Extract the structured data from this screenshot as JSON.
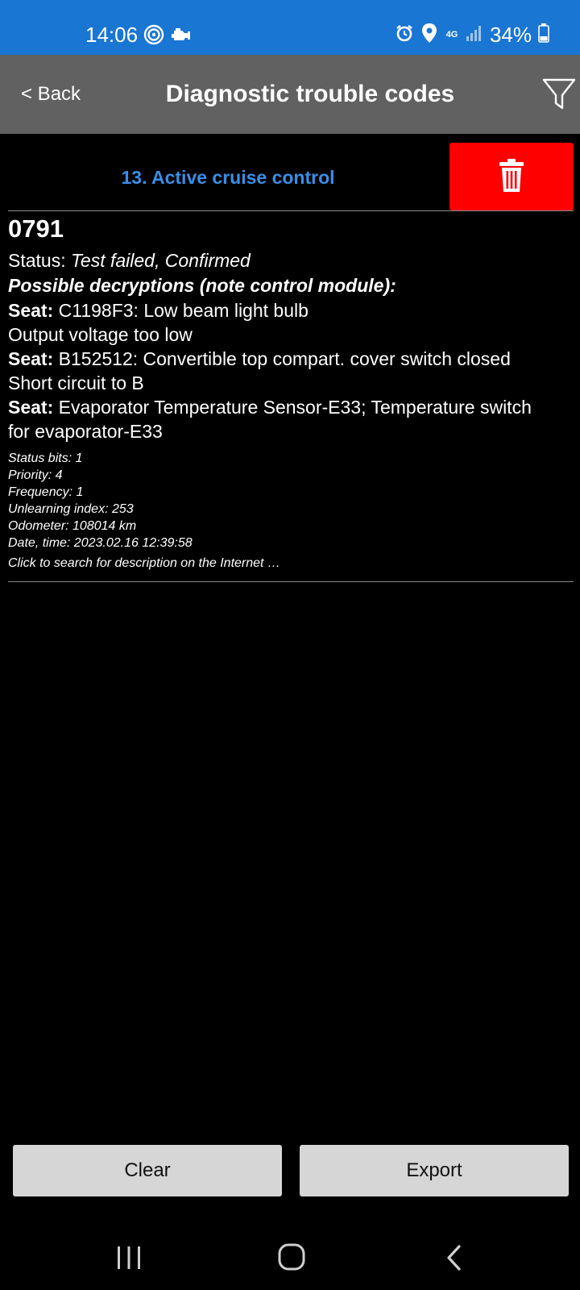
{
  "status_bar": {
    "time": "14:06",
    "network": "4G",
    "battery": "34%"
  },
  "header": {
    "back_label": "< Back",
    "title": "Diagnostic trouble codes"
  },
  "module": {
    "title": "13. Active cruise control"
  },
  "dtc": {
    "code": "0791",
    "status_label": "Status: ",
    "status_value": "Test failed, Confirmed",
    "possible_heading": "Possible decryptions (note control module):",
    "decryptions": [
      {
        "label": "Seat:",
        "line1": " C1198F3: Low beam light bulb",
        "line2": "Output voltage too low"
      },
      {
        "label": "Seat:",
        "line1": " B152512: Convertible top compart. cover switch closed",
        "line2": "Short circuit to B"
      },
      {
        "label": "Seat:",
        "line1": " Evaporator Temperature Sensor-E33; Temperature switch",
        "line2": "for evaporator-E33"
      }
    ],
    "meta": {
      "status_bits": "Status bits: 1",
      "priority": "Priority: 4",
      "frequency": "Frequency: 1",
      "unlearning_index": "Unlearning index: 253",
      "odometer": "Odometer: 108014 km",
      "date_time": "Date, time: 2023.02.16 12:39:58"
    },
    "search_hint": "Click to search for description on the Internet …"
  },
  "actions": {
    "clear_label": "Clear",
    "export_label": "Export"
  },
  "colors": {
    "status_bar": "#1976d2",
    "app_bar": "#616161",
    "module_title": "#3a8ee6",
    "delete_button": "#ff0000",
    "button_bg": "#d6d6d6"
  },
  "icons": {
    "status_left": [
      "nfc-icon",
      "car-engine-icon"
    ],
    "status_right": [
      "alarm-icon",
      "location-icon",
      "signal-icon",
      "battery-icon"
    ],
    "filter": "filter-icon",
    "delete": "trash-icon",
    "nav": [
      "recents-icon",
      "home-icon",
      "back-icon"
    ]
  }
}
